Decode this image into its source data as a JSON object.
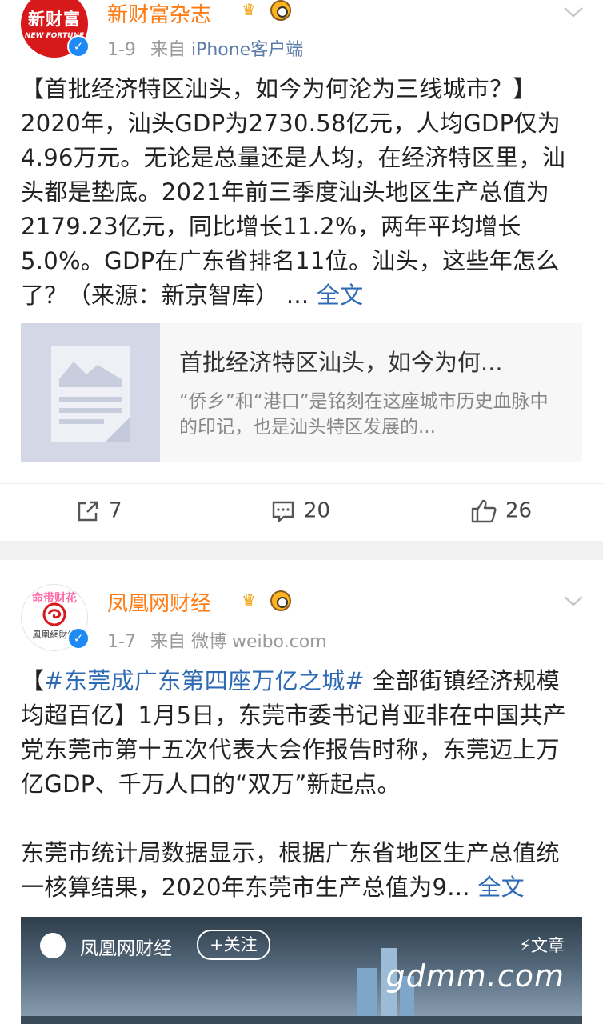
{
  "post1": {
    "avatar_text_top": "新财富",
    "avatar_text_bottom": "NEW FORTUNE",
    "name": "新财富杂志",
    "date": "1-9",
    "source_prefix": "来自",
    "source": "iPhone客户端",
    "body": "【首批经济特区汕头，如今为何沦为三线城市？】2020年，汕头GDP为2730.58亿元，人均GDP仅为4.96万元。无论是总量还是人均，在经济特区里，汕头都是垫底。2021年前三季度汕头地区生产总值为2179.23亿元，同比增长11.2%，两年平均增长5.0%。GDP在广东省排名11位。汕头，这些年怎么了？（来源：新京智库）",
    "ellipsis": " ...",
    "full_text": "全文",
    "card": {
      "title": "首批经济特区汕头，如今为何...",
      "desc": "“侨乡”和“港口”是铭刻在这座城市历史血脉中的印记，也是汕头特区发展的..."
    },
    "repost": "7",
    "comments": "20",
    "likes": "26"
  },
  "post2": {
    "avatar_ribbon": "命带财花",
    "avatar_text": "鳳凰網財經",
    "name": "凤凰网财经",
    "date": "1-7",
    "source_prefix": "来自",
    "source": "微博 weibo.com",
    "body_bracket_open": "【",
    "hashtag": "#东莞成广东第四座万亿之城#",
    "body_1": " 全部街镇经济规模均超百亿】1月5日，东莞市委书记肖亚非在中国共产党东莞市第十五次代表大会作报告时称，东莞迈上万亿GDP、千万人口的“双万”新起点。",
    "body_2": "东莞市统计局数据显示，根据广东省地区生产总值统一核算结果，2020年东莞市生产总值为9...",
    "full_text": "全文",
    "image_card": {
      "name": "凤凰网财经",
      "follow": "+关注",
      "article": "⚡文章",
      "watermark": "gdmm.com"
    }
  },
  "colors": {
    "name": "#ff7b13",
    "link": "#2f6bb5",
    "meta": "#999999",
    "verified": "#1e8af5"
  }
}
